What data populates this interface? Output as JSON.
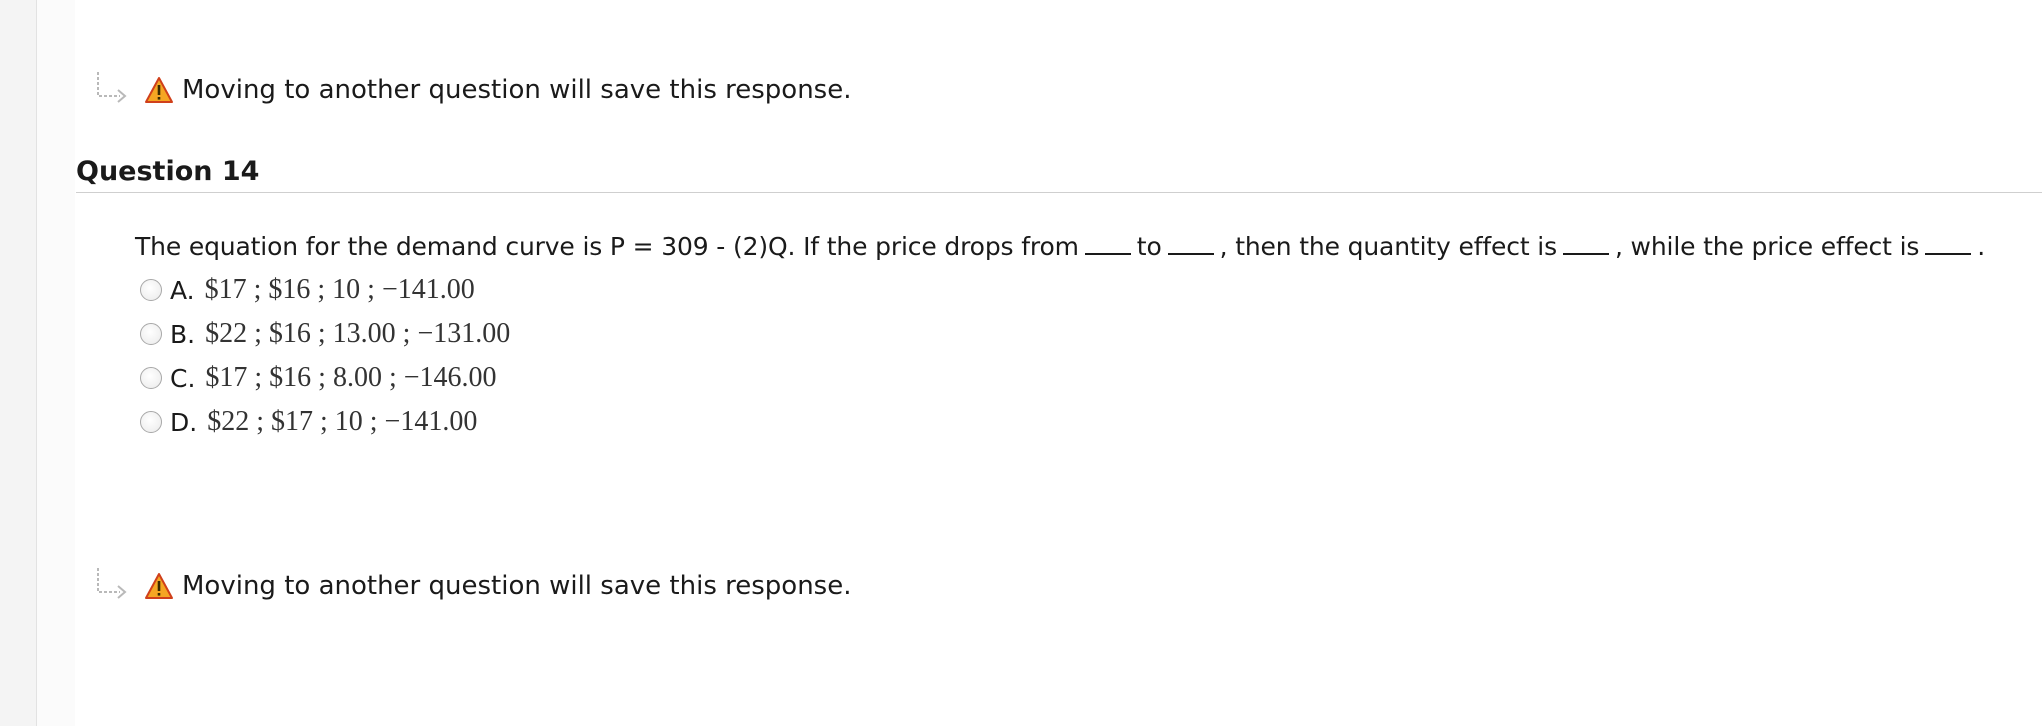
{
  "notices": {
    "top": "Moving to another question will save this response.",
    "bottom": "Moving to another question will save this response."
  },
  "question": {
    "title": "Question 14",
    "prompt_parts": [
      "The equation for the demand curve is P = 309 - (2)Q. If the price drops from",
      "to",
      ", then the quantity effect is",
      ", while the price effect is",
      "."
    ],
    "options": [
      {
        "letter": "A.",
        "value": "$17 ; $16 ; 10 ; −141.00"
      },
      {
        "letter": "B.",
        "value": "$22 ; $16 ; 13.00 ; −131.00"
      },
      {
        "letter": "C.",
        "value": "$17 ; $16 ; 8.00 ; −146.00"
      },
      {
        "letter": "D.",
        "value": "$22 ; $17 ; 10 ; −141.00"
      }
    ]
  },
  "icons": {
    "arrow": "return-arrow-icon",
    "warning": "warning-icon"
  },
  "colors": {
    "warning_fill": "#f5a623",
    "warning_stroke": "#d0401b"
  }
}
